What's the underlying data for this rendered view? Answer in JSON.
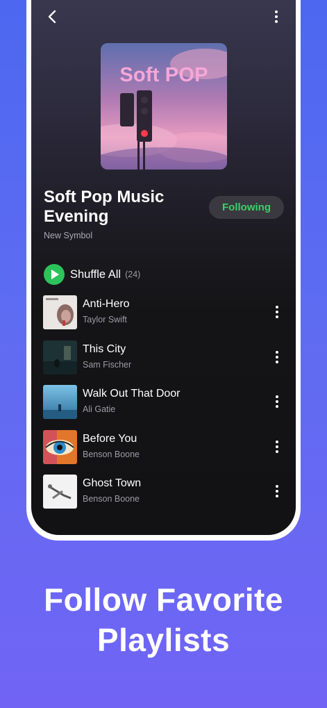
{
  "playlist": {
    "cover_text": "Soft POP",
    "title": "Soft Pop Music Evening",
    "owner": "New Symbol",
    "follow_label": "Following"
  },
  "shuffle": {
    "label": "Shuffle All",
    "count": "(24)"
  },
  "tracks": [
    {
      "title": "Anti-Hero",
      "artist": "Taylor Swift"
    },
    {
      "title": "This City",
      "artist": "Sam Fischer"
    },
    {
      "title": "Walk Out That Door",
      "artist": "Ali Gatie"
    },
    {
      "title": "Before You",
      "artist": "Benson Boone"
    },
    {
      "title": "Ghost Town",
      "artist": "Benson Boone"
    }
  ],
  "promo": {
    "headline_line1": "Follow Favorite",
    "headline_line2": "Playlists"
  },
  "icons": {
    "back": "chevron-left-icon",
    "more": "more-vertical-icon",
    "play": "play-icon"
  },
  "colors": {
    "accent_green": "#2cc35a",
    "following_text": "#3ecf6a",
    "background_top": "#4d67f0",
    "background_bottom": "#7164f4"
  }
}
